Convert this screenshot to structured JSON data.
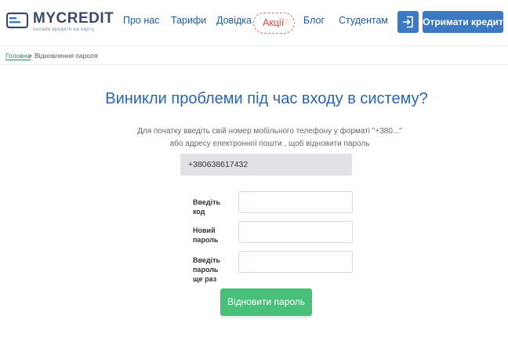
{
  "header": {
    "logo_text": "MYCREDIT",
    "logo_tagline": "онлайн кредити на карту",
    "nav": [
      "Про нас",
      "Тарифи",
      "Довідка",
      "Акції",
      "Блог",
      "Студентам"
    ],
    "cta_label": "Отримати кредит",
    "login_icon": "login-icon",
    "promo_icon": "star-icon"
  },
  "breadcrumb": {
    "home": "Головна",
    "separator": ">",
    "current": "Відновлення пароля"
  },
  "main": {
    "title": "Виникли проблеми під час входу в систему?",
    "description_line1": "Для початку введіть свій номер мобільного телефону у форматі \"+380...\"",
    "description_line2": "або адресу електронної пошти , щоб відновити пароль",
    "phone_value": "+380638617432",
    "fields": [
      {
        "label": "Введіть код",
        "value": ""
      },
      {
        "label": "Новий пароль",
        "value": ""
      },
      {
        "label": "Введіть пароль ще раз",
        "value": ""
      }
    ],
    "submit_label": "Відновити пароль"
  },
  "colors": {
    "brand_blue": "#3c79c3",
    "link_blue": "#1d5aa8",
    "title_blue": "#2a64b3",
    "promo_red": "#d94a4a",
    "success_green": "#48c07a",
    "crumb_green": "#2e8b57"
  }
}
